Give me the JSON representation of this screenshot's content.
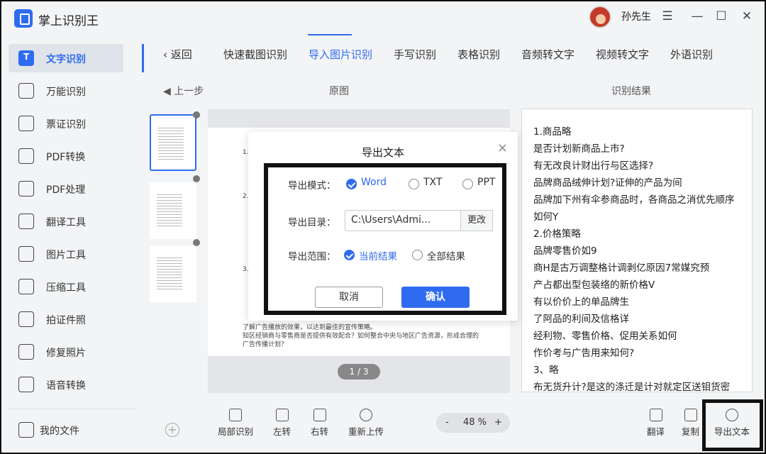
{
  "app": {
    "title": "掌上识别王",
    "user": "孙先生"
  },
  "window": {
    "menu": "☰",
    "minimize": "—",
    "maximize": "☐",
    "close": "✕"
  },
  "sidebar": {
    "items": [
      {
        "label": "文字识别",
        "icon": "text-recognition-icon"
      },
      {
        "label": "万能识别",
        "icon": "universal-scan-icon"
      },
      {
        "label": "票证识别",
        "icon": "ticket-icon"
      },
      {
        "label": "PDF转换",
        "icon": "pdf-convert-icon"
      },
      {
        "label": "PDF处理",
        "icon": "pdf-process-icon"
      },
      {
        "label": "翻译工具",
        "icon": "translate-icon"
      },
      {
        "label": "图片工具",
        "icon": "image-tool-icon"
      },
      {
        "label": "压缩工具",
        "icon": "compress-icon"
      },
      {
        "label": "拍证件照",
        "icon": "id-photo-icon"
      },
      {
        "label": "修复照片",
        "icon": "repair-photo-icon"
      },
      {
        "label": "语音转换",
        "icon": "voice-convert-icon"
      }
    ],
    "my_files": "我的文件"
  },
  "tabs": {
    "back": "返回",
    "items": [
      "快速截图识别",
      "导入图片识别",
      "手写识别",
      "表格识别",
      "音频转文字",
      "视频转文字",
      "外语识别"
    ],
    "active": "导入图片识别"
  },
  "subbar": {
    "prev_step": "上一步",
    "original": "原图",
    "result": "识别结果"
  },
  "preview": {
    "pager": "1 / 3",
    "paper_lines": [
      "1.",
      "2.",
      "3.",
      "了解广告播放的效果，以达到最佳的宣传策略。",
      "知区经销商与零售商是否提供有效配合？如何整合中央与地区广告资源，形成合理的",
      "广告传播计划？"
    ]
  },
  "result_lines": [
    "1.商品略",
    "是否计划新商品上市?",
    "有无改良计财出行与区选择?",
    "品牌商品绒伸计划?证伸的产品为间",
    "品牌加下州有伞参商品时，各商品之消优先顺序",
    "如何Y",
    "2.价格策略",
    "品牌零售价如9",
    "商H是古万调整格计调剥亿原因7常媒究预",
    "产占都出型包装络的新价格V",
    "有以价价上的单品牌生",
    "了阿品的利间及信格详",
    "经利物、零售价格、促用关系如何",
    "作价考与广告用来知何?",
    "3、略",
    "布无货升计?是这的涤迁是计对就定区送钼货密"
  ],
  "toolbar": {
    "local_recognize": "局部识别",
    "rotate_left": "左转",
    "rotate_right": "右转",
    "reupload": "重新上传",
    "zoom_minus": "-",
    "zoom_value": "48 %",
    "zoom_plus": "+",
    "translate": "翻译",
    "copy": "复制",
    "export_text": "导出文本"
  },
  "dialog": {
    "title": "导出文本",
    "close": "×",
    "mode_label": "导出模式：",
    "modes": [
      "Word",
      "TXT",
      "PPT"
    ],
    "selected_mode": "Word",
    "dir_label": "导出目录：",
    "dir_value": "C:\\Users\\Admi...",
    "change_button": "更改",
    "range_label": "导出范围：",
    "ranges": [
      "当前结果",
      "全部结果"
    ],
    "selected_range": "当前结果",
    "cancel": "取消",
    "confirm": "确认"
  },
  "colors": {
    "accent": "#2f6bf0",
    "highlight_border": "#111111"
  }
}
